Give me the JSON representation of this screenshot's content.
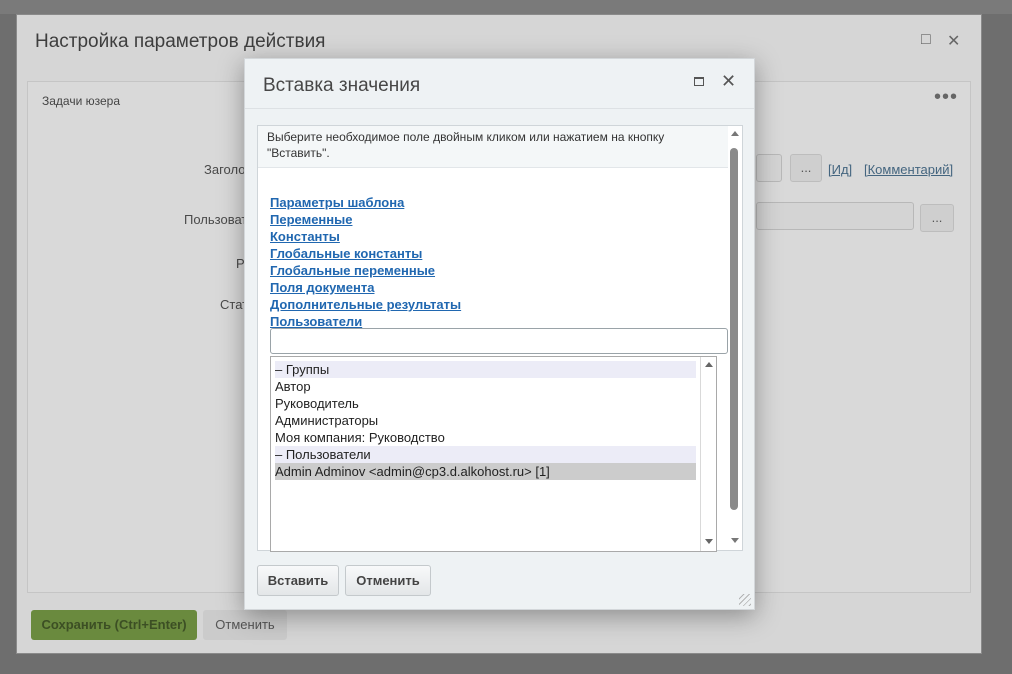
{
  "background": {
    "topbar_tabs": [
      "",
      "",
      "",
      "",
      ""
    ],
    "dialog_title": "Настройка параметров действия",
    "panel_title": "Задачи юзера",
    "labels": [
      "Заголо",
      "Пользоват",
      "Р",
      "Стат"
    ],
    "id_link": "[Ид]",
    "comment_link": "[Комментарий]",
    "browse_label": "...",
    "save_button": "Сохранить (Ctrl+Enter)",
    "cancel_button": "Отменить"
  },
  "modal": {
    "title": "Вставка значения",
    "info_text": "Выберите необходимое поле двойным кликом или нажатием на кнопку \"Вставить\".",
    "links": [
      "Параметры шаблона",
      "Переменные",
      "Константы",
      "Глобальные константы",
      "Глобальные переменные",
      "Поля документа",
      "Дополнительные результаты",
      "Пользователи"
    ],
    "search": {
      "value": "",
      "placeholder": ""
    },
    "list_items": [
      {
        "text": "– Группы",
        "kind": "group"
      },
      {
        "text": "Автор",
        "kind": "item"
      },
      {
        "text": "Руководитель",
        "kind": "item"
      },
      {
        "text": "Администраторы",
        "kind": "item"
      },
      {
        "text": "Моя компания: Руководство",
        "kind": "item"
      },
      {
        "text": "– Пользователи",
        "kind": "group"
      },
      {
        "text": "Admin Adminov <admin@cp3.d.alkohost.ru> [1]",
        "kind": "selected"
      }
    ],
    "insert_button": "Вставить",
    "cancel_button": "Отменить"
  },
  "icons": {
    "maximize": "maximize-icon",
    "close": "close-icon",
    "more": "more-dots-icon"
  }
}
